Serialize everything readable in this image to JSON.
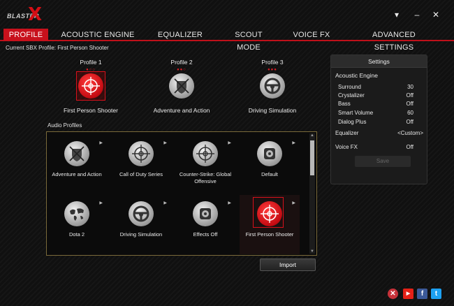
{
  "window": {
    "logo_text": "BLASTER",
    "logo_x": "X",
    "dropdown_icon": "▾",
    "minimize_icon": "–",
    "close_icon": "✕"
  },
  "tabs": [
    {
      "label": "PROFILE",
      "active": true
    },
    {
      "label": "ACOUSTIC ENGINE",
      "active": false
    },
    {
      "label": "EQUALIZER",
      "active": false
    },
    {
      "label": "SCOUT MODE",
      "active": false
    },
    {
      "label": "VOICE FX",
      "active": false
    },
    {
      "label": "ADVANCED SETTINGS",
      "active": false
    }
  ],
  "current_profile_text": "Current SBX Profile: First Person Shooter",
  "profiles": [
    {
      "title": "Profile 1",
      "dots": "●○○",
      "name": "First Person Shooter",
      "icon": "crosshair-icon"
    },
    {
      "title": "Profile 2",
      "dots": "●●○",
      "name": "Adventure and Action",
      "icon": "shield-swords-icon"
    },
    {
      "title": "Profile 3",
      "dots": "●●●",
      "name": "Driving Simulation",
      "icon": "steering-wheel-icon"
    }
  ],
  "audio_profiles_label": "Audio Profiles",
  "audio_profiles": [
    {
      "name": "Adventure and Action",
      "icon": "shield-swords-icon"
    },
    {
      "name": "Call of Duty Series",
      "icon": "crosshair-icon"
    },
    {
      "name": "Counter-Strike: Global Offensive",
      "icon": "crosshair-icon"
    },
    {
      "name": "Default",
      "icon": "speaker-icon"
    },
    {
      "name": "Dota 2",
      "icon": "world-map-icon"
    },
    {
      "name": "Driving Simulation",
      "icon": "steering-wheel-icon"
    },
    {
      "name": "Effects Off",
      "icon": "speaker-icon"
    },
    {
      "name": "First Person Shooter",
      "icon": "crosshair-icon"
    }
  ],
  "arrow_glyph": "▶",
  "import_label": "Import",
  "settings": {
    "title": "Settings",
    "acoustic_engine_label": "Acoustic Engine",
    "rows": [
      {
        "label": "Surround",
        "value": "30"
      },
      {
        "label": "Crystalizer",
        "value": "Off"
      },
      {
        "label": "Bass",
        "value": "Off"
      },
      {
        "label": "Smart Volume",
        "value": "60"
      },
      {
        "label": "Dialog Plus",
        "value": "Off"
      }
    ],
    "equalizer_label": "Equalizer",
    "equalizer_value": "<Custom>",
    "voice_fx_label": "Voice FX",
    "voice_fx_value": "Off",
    "save_label": "Save"
  },
  "social": [
    {
      "icon": "close-circle-icon",
      "glyph": "✕",
      "color": "#c7323a"
    },
    {
      "icon": "youtube-icon",
      "glyph": "▶",
      "color": "#e62117"
    },
    {
      "icon": "facebook-icon",
      "glyph": "f",
      "color": "#3b5998"
    },
    {
      "icon": "twitter-icon",
      "glyph": "t",
      "color": "#1da1f2"
    }
  ],
  "colors": {
    "accent": "#c8111c",
    "background": "#101010"
  }
}
